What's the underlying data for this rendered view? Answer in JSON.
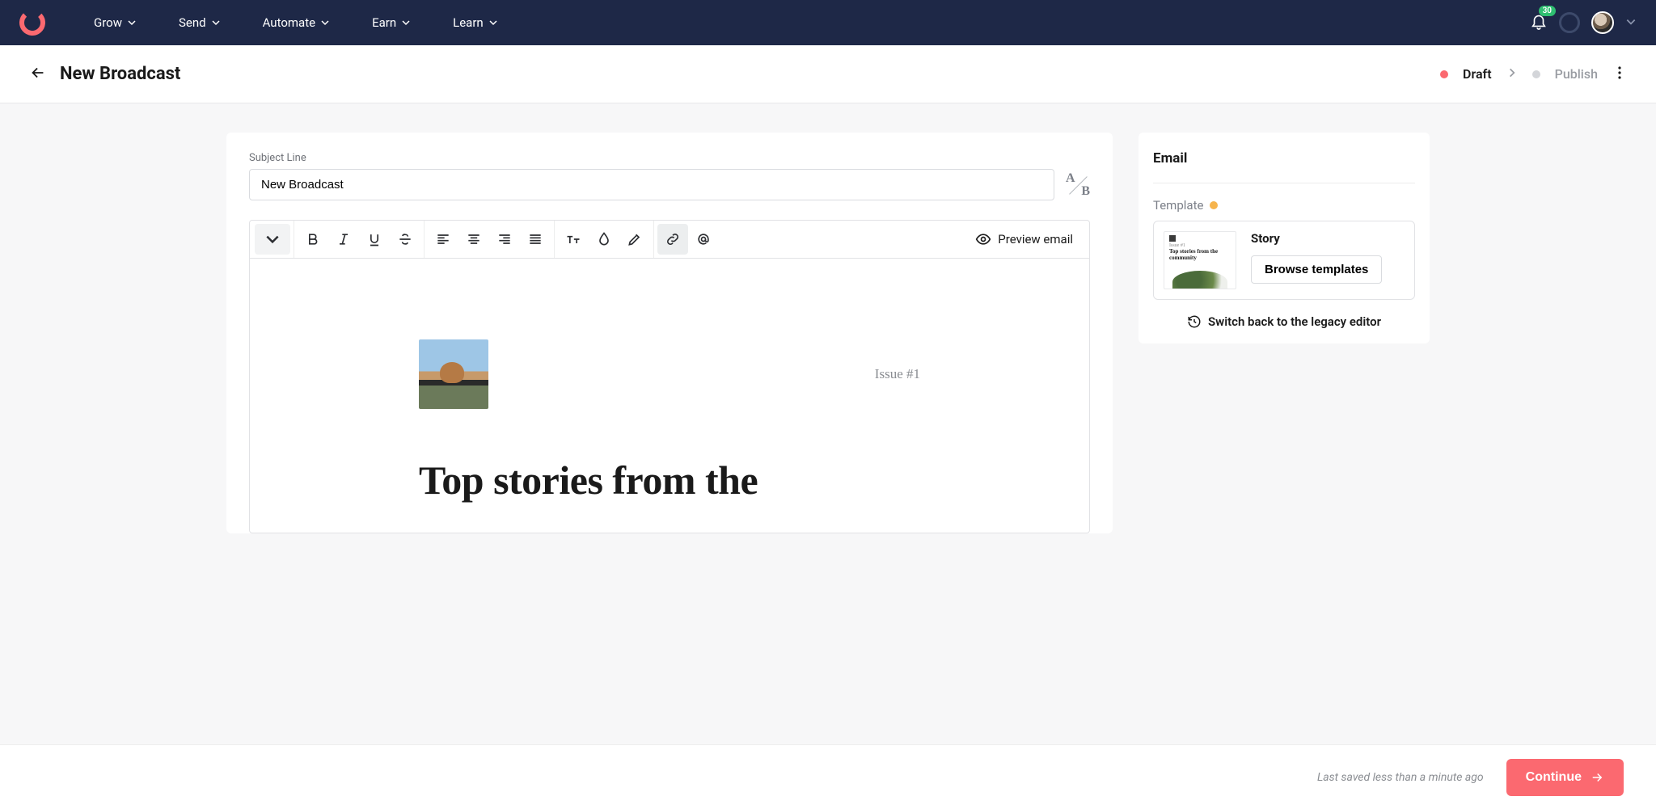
{
  "nav": {
    "items": [
      "Grow",
      "Send",
      "Automate",
      "Earn",
      "Learn"
    ],
    "notification_count": "30"
  },
  "header": {
    "title": "New Broadcast",
    "status_primary": "Draft",
    "status_secondary": "Publish"
  },
  "editor": {
    "subject_label": "Subject Line",
    "subject_value": "New Broadcast",
    "preview_label": "Preview email",
    "content": {
      "issue": "Issue #1",
      "headline": "Top stories from the"
    }
  },
  "sidebar": {
    "title": "Email",
    "template_label": "Template",
    "template": {
      "name": "Story",
      "thumb_text": "Top stories from the community",
      "browse_label": "Browse templates"
    },
    "legacy_label": "Switch back to the legacy editor"
  },
  "footer": {
    "saved_text": "Last saved less than a minute ago",
    "continue_label": "Continue"
  }
}
